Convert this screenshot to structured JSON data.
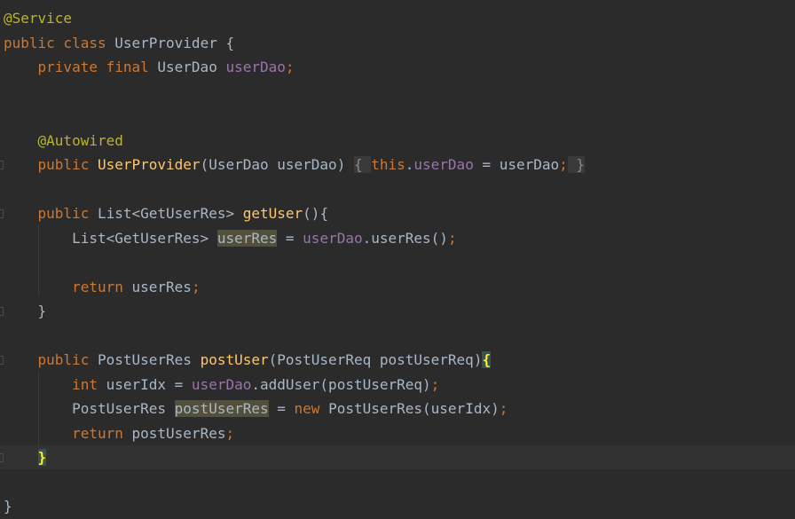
{
  "editor": {
    "language": "java",
    "colors": {
      "background": "#2b2b2b",
      "current_line": "#323232",
      "annotation": "#bbb529",
      "keyword": "#cc7832",
      "field": "#9876aa",
      "method_declaration": "#ffc66d",
      "default_text": "#a9b7c6",
      "occurrence_highlight": "#52503a",
      "matched_brace": "#ffef28"
    },
    "lines": [
      {
        "tokens": [
          {
            "t": "@Service",
            "c": "ann"
          }
        ]
      },
      {
        "tokens": [
          {
            "t": "public class ",
            "c": "kw"
          },
          {
            "t": "UserProvider {",
            "c": "txt"
          }
        ]
      },
      {
        "tokens": [
          {
            "t": "    "
          },
          {
            "t": "private final ",
            "c": "kw"
          },
          {
            "t": "UserDao ",
            "c": "txt"
          },
          {
            "t": "userDao",
            "c": "fld"
          },
          {
            "t": ";",
            "c": "kw"
          }
        ]
      },
      {
        "tokens": []
      },
      {
        "tokens": []
      },
      {
        "tokens": [
          {
            "t": "    "
          },
          {
            "t": "@Autowired",
            "c": "ann"
          }
        ]
      },
      {
        "fold": true,
        "tokens": [
          {
            "t": "    "
          },
          {
            "t": "public ",
            "c": "kw"
          },
          {
            "t": "UserProvider",
            "c": "mth"
          },
          {
            "t": "(UserDao userDao) ",
            "c": "txt"
          },
          {
            "t": "{ ",
            "c": "fold-brace"
          },
          {
            "t": "this",
            "c": "kw"
          },
          {
            "t": ".",
            "c": "txt"
          },
          {
            "t": "userDao",
            "c": "fld"
          },
          {
            "t": " = userDao",
            "c": "txt"
          },
          {
            "t": ";",
            "c": "kw"
          },
          {
            "t": " }",
            "c": "fold-brace"
          }
        ]
      },
      {
        "tokens": []
      },
      {
        "fold": true,
        "tokens": [
          {
            "t": "    "
          },
          {
            "t": "public ",
            "c": "kw"
          },
          {
            "t": "List<GetUserRes> ",
            "c": "txt"
          },
          {
            "t": "getUser",
            "c": "mth"
          },
          {
            "t": "(){",
            "c": "txt"
          }
        ]
      },
      {
        "tokens": [
          {
            "t": "        "
          },
          {
            "t": "List<GetUserRes> ",
            "c": "txt"
          },
          {
            "t": "userRes",
            "c": "hl-var"
          },
          {
            "t": " = ",
            "c": "txt"
          },
          {
            "t": "userDao",
            "c": "fld"
          },
          {
            "t": ".userRes()",
            "c": "txt"
          },
          {
            "t": ";",
            "c": "kw"
          }
        ]
      },
      {
        "tokens": []
      },
      {
        "tokens": [
          {
            "t": "        "
          },
          {
            "t": "return ",
            "c": "kw"
          },
          {
            "t": "userRes",
            "c": "txt"
          },
          {
            "t": ";",
            "c": "kw"
          }
        ]
      },
      {
        "fold": true,
        "tokens": [
          {
            "t": "    "
          },
          {
            "t": "}",
            "c": "txt"
          }
        ]
      },
      {
        "tokens": []
      },
      {
        "fold": true,
        "tokens": [
          {
            "t": "    "
          },
          {
            "t": "public ",
            "c": "kw"
          },
          {
            "t": "PostUserRes ",
            "c": "txt"
          },
          {
            "t": "postUser",
            "c": "mth"
          },
          {
            "t": "(PostUserReq postUserReq)",
            "c": "txt"
          },
          {
            "t": "{",
            "c": "brace-match"
          }
        ]
      },
      {
        "tokens": [
          {
            "t": "        "
          },
          {
            "t": "int ",
            "c": "kw"
          },
          {
            "t": "userIdx = ",
            "c": "txt"
          },
          {
            "t": "userDao",
            "c": "fld"
          },
          {
            "t": ".addUser(postUserReq)",
            "c": "txt"
          },
          {
            "t": ";",
            "c": "kw"
          }
        ]
      },
      {
        "tokens": [
          {
            "t": "        "
          },
          {
            "t": "PostUserRes ",
            "c": "txt"
          },
          {
            "t": "postUserRes",
            "c": "hl-var"
          },
          {
            "t": " = ",
            "c": "txt"
          },
          {
            "t": "new ",
            "c": "kw"
          },
          {
            "t": "PostUserRes(userIdx)",
            "c": "txt"
          },
          {
            "t": ";",
            "c": "kw"
          }
        ]
      },
      {
        "tokens": [
          {
            "t": "        "
          },
          {
            "t": "return ",
            "c": "kw"
          },
          {
            "t": "postUserRes",
            "c": "txt"
          },
          {
            "t": ";",
            "c": "kw"
          }
        ]
      },
      {
        "fold": true,
        "current": true,
        "tokens": [
          {
            "t": "    "
          },
          {
            "t": "}",
            "c": "brace-match"
          }
        ]
      },
      {
        "tokens": []
      },
      {
        "tokens": [
          {
            "t": "}",
            "c": "txt"
          }
        ]
      }
    ]
  }
}
